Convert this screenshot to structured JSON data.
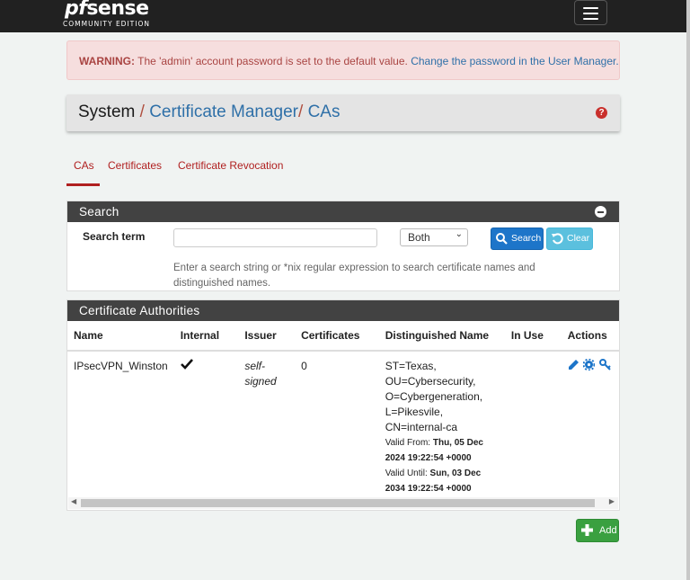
{
  "navbar": {
    "logo_main_pf": "pf",
    "logo_main_rest": "sense",
    "logo_sub": "COMMUNITY EDITION",
    "menu_icon": "hamburger-icon"
  },
  "alert": {
    "label": "WARNING:",
    "text": " The 'admin' account password is set to the default value. ",
    "link": "Change the password in the User Manager."
  },
  "breadcrumb": {
    "system": "System",
    "sep": "/",
    "cert_manager": "Certificate Manager",
    "current": "CAs",
    "help_icon": "question-circle-icon"
  },
  "tabs": [
    {
      "label": "CAs",
      "active": true
    },
    {
      "label": "Certificates",
      "active": false
    },
    {
      "label": "Certificate Revocation",
      "active": false
    }
  ],
  "search_panel": {
    "title": "Search",
    "term_label": "Search term",
    "term_value": "",
    "scope_selected": "Both",
    "search_button": "Search",
    "clear_button": "Clear",
    "help_text": "Enter a search string or *nix regular expression to search certificate names and distinguished names."
  },
  "ca_panel": {
    "title": "Certificate Authorities",
    "columns": [
      "Name",
      "Internal",
      "Issuer",
      "Certificates",
      "Distinguished Name",
      "In Use",
      "Actions"
    ],
    "rows": [
      {
        "name": "IPsecVPN_Winston",
        "internal_icon": "check-icon",
        "issuer_line1": "self-",
        "issuer_line2": "signed",
        "certificates": "0",
        "dn_st": "ST=Texas,",
        "dn_ou": "OU=Cybersecurity,",
        "dn_o": "O=Cybergeneration,",
        "dn_l": "L=Pikesvile,",
        "dn_cn": "CN=internal-ca",
        "valid_from_label": "Valid From: ",
        "valid_from_value": "Thu, 05 Dec 2024 19:22:54 +0000",
        "valid_until_label": "Valid Until: ",
        "valid_until_value": "Sun, 03 Dec 2034 19:22:54 +0000",
        "in_use": "",
        "actions": [
          "pencil-icon",
          "gear-icon",
          "key-icon"
        ]
      }
    ]
  },
  "add_button": "Add",
  "colors": {
    "navbar": "#212121",
    "accent_red": "#b02020",
    "link_blue": "#2f70a8",
    "panel_heading": "#424242",
    "add_green": "#3aa040"
  }
}
